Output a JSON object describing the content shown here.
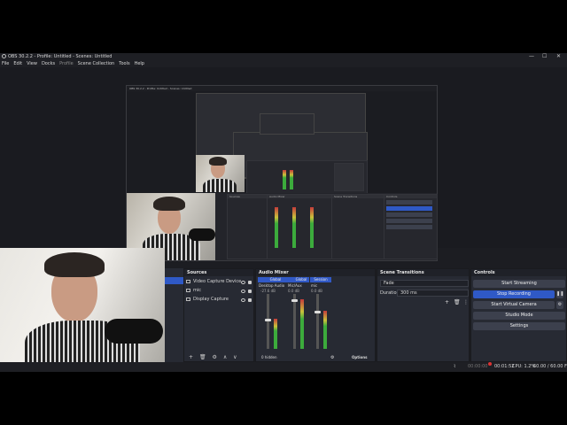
{
  "window": {
    "title": "OBS 30.2.2 - Profile: Untitled - Scenes: Untitled",
    "controls": [
      "—",
      "☐",
      "✕"
    ]
  },
  "menu": [
    "File",
    "Edit",
    "View",
    "Docks",
    "Profile",
    "Scene Collection",
    "Tools",
    "Help"
  ],
  "sources": {
    "title": "Sources",
    "items": [
      {
        "label": "Video Capture Device",
        "icon": "camera-icon"
      },
      {
        "label": "mic",
        "icon": "microphone-icon"
      },
      {
        "label": "Display Capture",
        "icon": "monitor-icon"
      }
    ],
    "toolbar": [
      "+",
      "🗑",
      "⚙",
      "∧",
      "∨"
    ]
  },
  "mixer": {
    "title": "Audio Mixer",
    "channels": [
      {
        "label": "Global",
        "name": "Desktop Audio",
        "db": "-27.6 dB",
        "level": 0.55
      },
      {
        "label": "Global",
        "name": "Mic/Aux",
        "db": "0.0 dB",
        "level": 0.9
      },
      {
        "label": "Session",
        "name": "mic",
        "db": "0.0 dB",
        "level": 0.7
      }
    ],
    "footer_left": "0 hidden",
    "options": "Options"
  },
  "transitions": {
    "title": "Scene Transitions",
    "type": "Fade",
    "duration_label": "Duration",
    "duration_value": "300 ms"
  },
  "controls": {
    "title": "Controls",
    "buttons": [
      {
        "label": "Start Streaming",
        "active": false
      },
      {
        "label": "Stop Recording",
        "active": true
      },
      {
        "label": "Start Virtual Camera",
        "active": false
      },
      {
        "label": "Studio Mode",
        "active": false
      },
      {
        "label": "Settings",
        "active": false
      }
    ]
  },
  "status": {
    "stream_time": "00:00:00",
    "rec_time": "00:01:52",
    "cpu": "CPU: 1.2%",
    "fps": "60.00 / 60.00 FPS"
  },
  "nested": {
    "title": "OBS 30.2.2 - Profile: Untitled - Scenes: Untitled"
  }
}
